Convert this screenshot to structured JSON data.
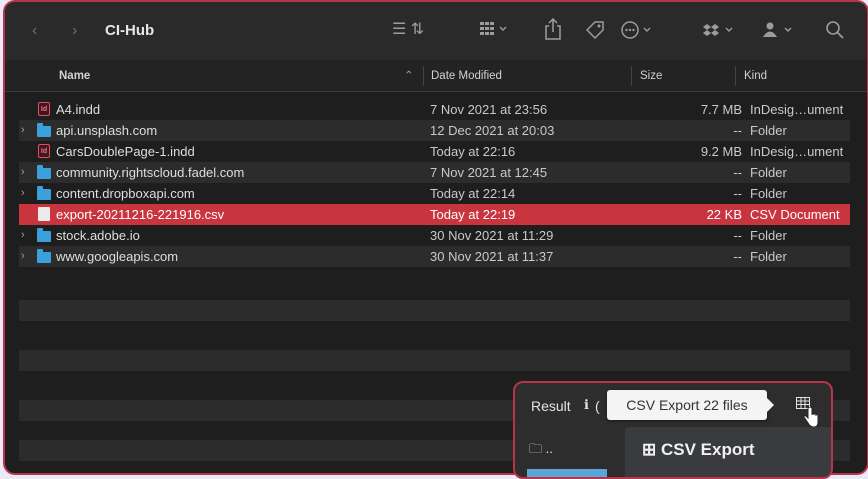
{
  "toolbar": {
    "back_icon": "chevron-left-icon",
    "forward_icon": "chevron-right-icon",
    "title": "CI-Hub",
    "view_icon": "list-view-icon",
    "group_icon": "group-grid-icon",
    "share_icon": "share-icon",
    "tag_icon": "tag-icon",
    "more_icon": "more-circle-icon",
    "dropbox_icon": "dropbox-icon",
    "gear_icon": "user-icon",
    "search_icon": "search-icon"
  },
  "columns": {
    "name": "Name",
    "date": "Date Modified",
    "size": "Size",
    "kind": "Kind"
  },
  "files": [
    {
      "type": "indd",
      "name": "A4.indd",
      "date": "7 Nov 2021 at 23:56",
      "size": "7.7 MB",
      "kind": "InDesig…ument",
      "expandable": false
    },
    {
      "type": "folder",
      "name": "api.unsplash.com",
      "date": "12 Dec 2021 at 20:03",
      "size": "--",
      "kind": "Folder",
      "expandable": true
    },
    {
      "type": "indd",
      "name": "CarsDoublePage-1.indd",
      "date": "Today at 22:16",
      "size": "9.2 MB",
      "kind": "InDesig…ument",
      "expandable": false
    },
    {
      "type": "folder",
      "name": "community.rightscloud.fadel.com",
      "date": "7 Nov 2021 at 12:45",
      "size": "--",
      "kind": "Folder",
      "expandable": true
    },
    {
      "type": "folder",
      "name": "content.dropboxapi.com",
      "date": "Today at 22:14",
      "size": "--",
      "kind": "Folder",
      "expandable": true
    },
    {
      "type": "csv",
      "name": "export-20211216-221916.csv",
      "date": "Today at 22:19",
      "size": "22 KB",
      "kind": "CSV Document",
      "expandable": false,
      "selected": true
    },
    {
      "type": "folder",
      "name": "stock.adobe.io",
      "date": "30 Nov 2021 at 11:29",
      "size": "--",
      "kind": "Folder",
      "expandable": true
    },
    {
      "type": "folder",
      "name": "www.googleapis.com",
      "date": "30 Nov 2021 at 11:37",
      "size": "--",
      "kind": "Folder",
      "expandable": true
    }
  ],
  "popup": {
    "result_label": "Result",
    "info_icon": "info-icon",
    "result_suffix": "(",
    "tooltip": "CSV Export 22 files",
    "table_icon": "table-icon",
    "folder_up": "🗀 ..",
    "panel_title": "⊞ CSV Export"
  },
  "colors": {
    "accent": "#c8353f",
    "window_border": "#b9334a",
    "folder": "#3aa1dd"
  }
}
